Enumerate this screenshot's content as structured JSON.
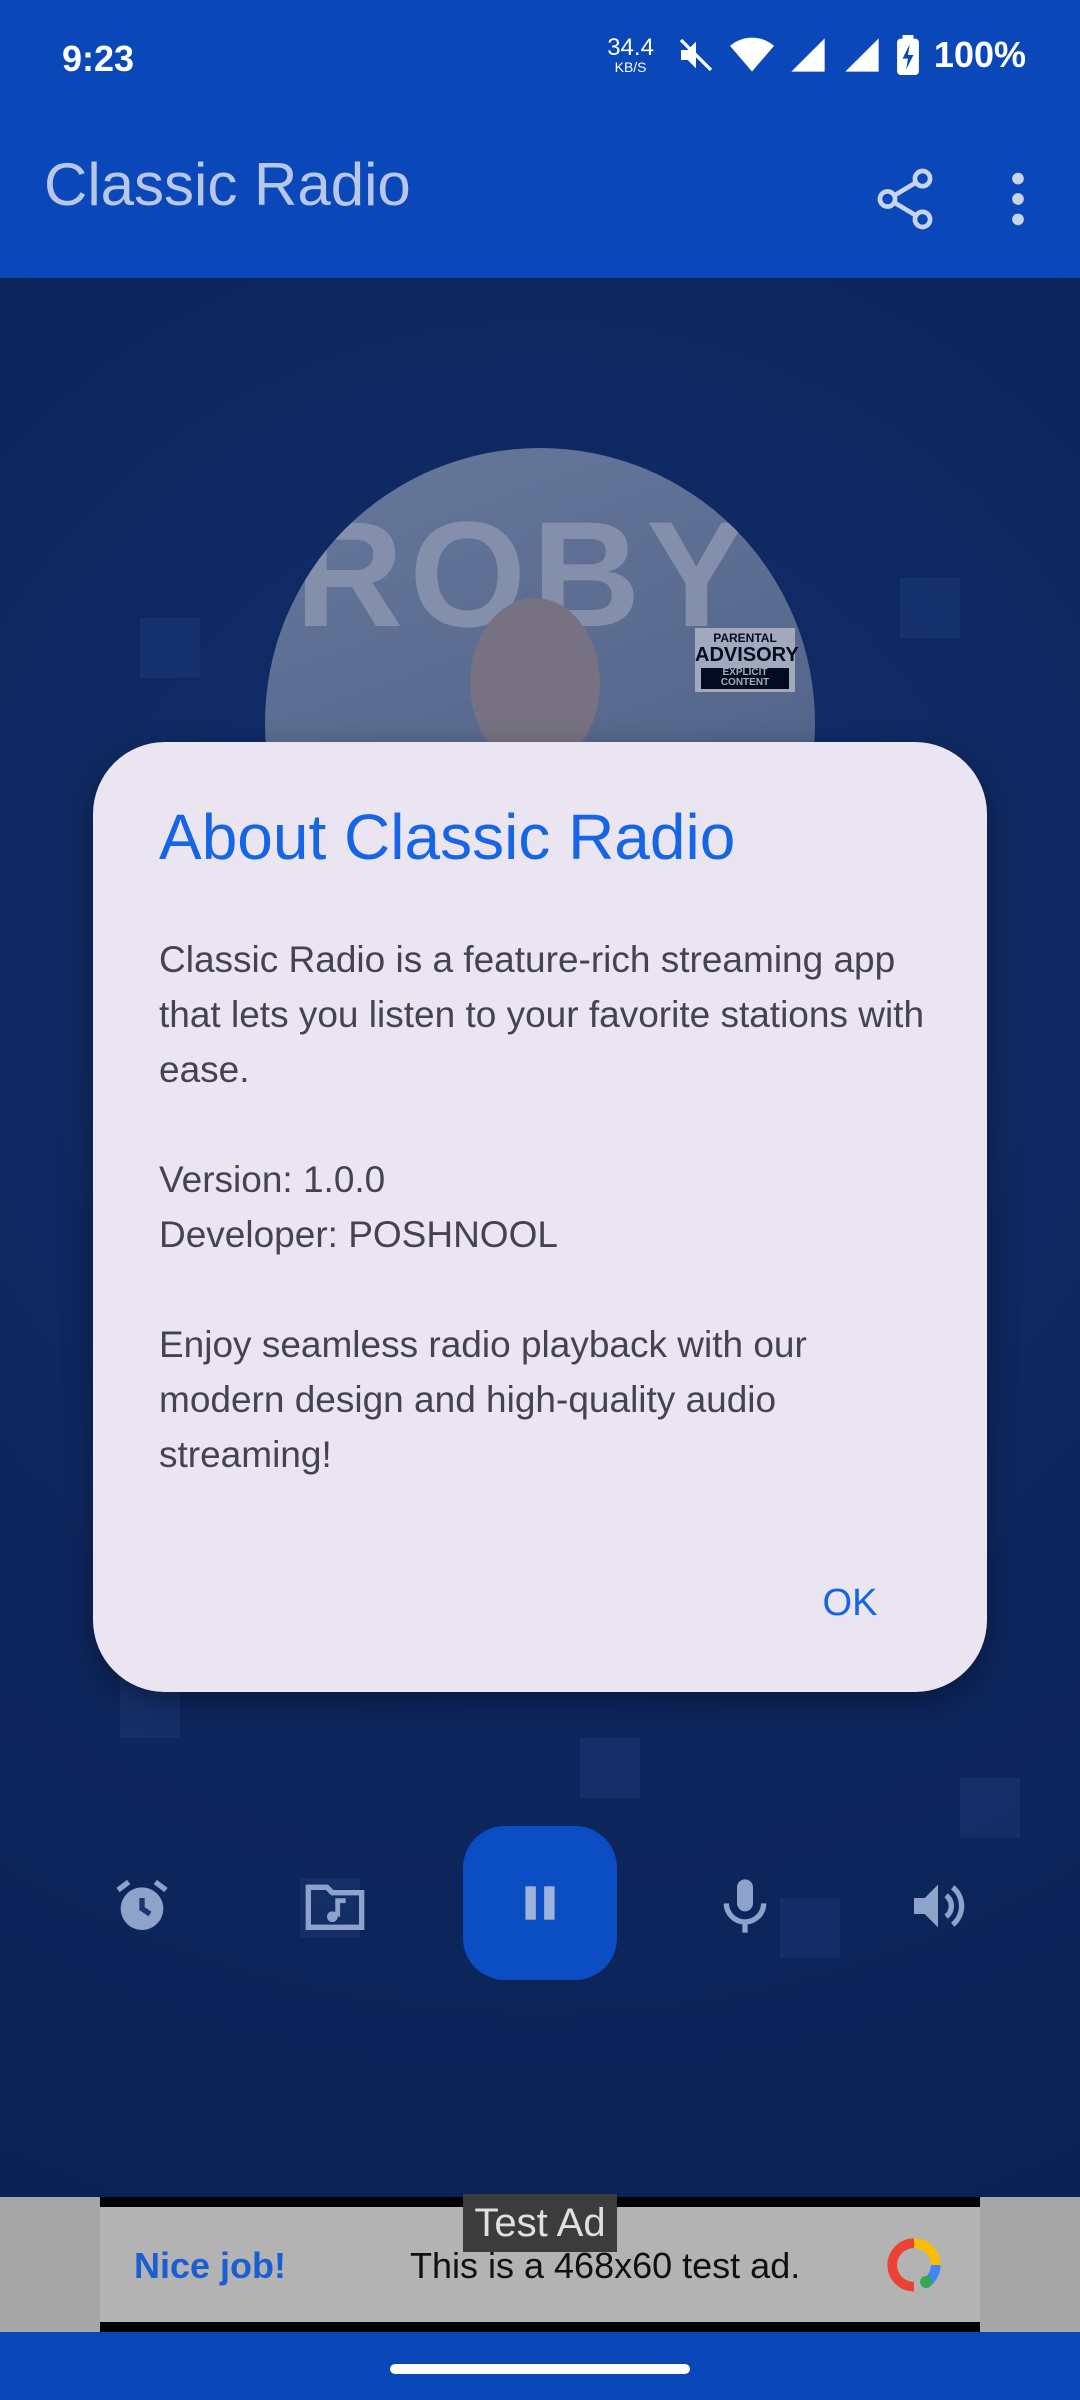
{
  "status_bar": {
    "time": "9:23",
    "net_speed_value": "34.4",
    "net_speed_unit": "KB/S",
    "battery": "100%"
  },
  "app_bar": {
    "title": "Classic Radio",
    "share_icon": "share-icon",
    "more_icon": "more-vert-icon"
  },
  "album": {
    "art_text": "ROBY",
    "advisory_top": "PARENTAL",
    "advisory_mid": "ADVISORY",
    "advisory_bottom": "EXPLICIT CONTENT"
  },
  "dialog": {
    "title": "About Classic Radio",
    "paragraph1": "Classic Radio is a feature-rich streaming app that lets you listen to your favorite stations with ease.",
    "version": "Version: 1.0.0",
    "developer": "Developer: POSHNOOL",
    "paragraph2": "Enjoy seamless radio playback with our modern design and high-quality audio streaming!",
    "ok_label": "OK"
  },
  "controls": {
    "items": [
      "alarm-icon",
      "music-folder-icon",
      "pause-icon",
      "microphone-icon",
      "volume-icon"
    ]
  },
  "ad": {
    "badge": "Test Ad",
    "nice_job": "Nice job!",
    "text": "This is a 468x60 test ad."
  },
  "colors": {
    "primary": "#0a47b8",
    "accent": "#1565e6",
    "dialog_bg": "#eae5f1"
  }
}
